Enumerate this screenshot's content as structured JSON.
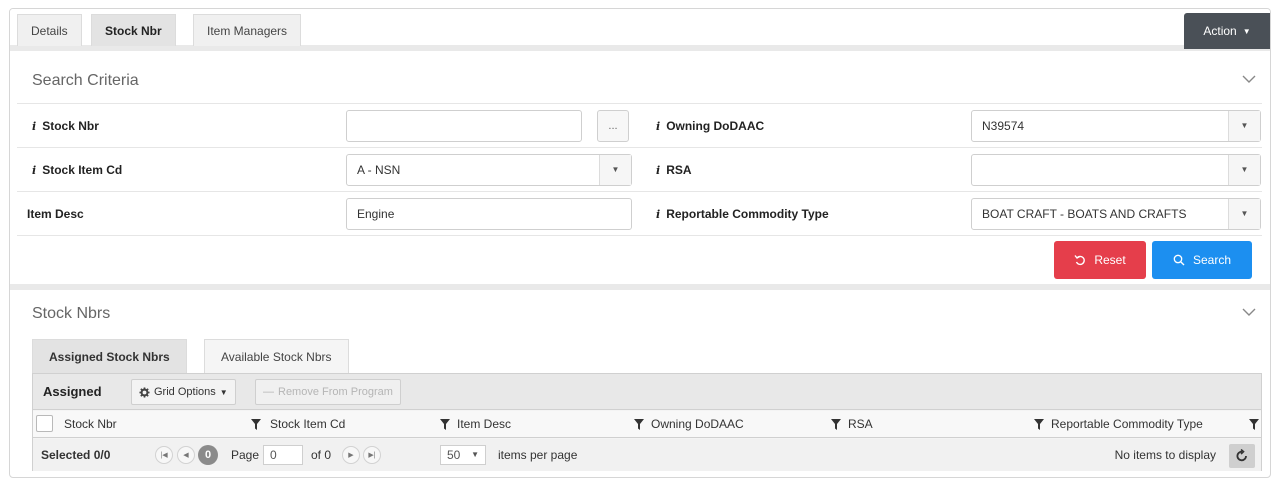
{
  "tabs": [
    {
      "label": "Details"
    },
    {
      "label": "Stock Nbr"
    },
    {
      "label": "Item Managers"
    }
  ],
  "action": {
    "label": "Action"
  },
  "search_criteria": {
    "title": "Search Criteria",
    "left": [
      {
        "label": "Stock Nbr",
        "value": ""
      },
      {
        "label": "Stock Item Cd",
        "value": "A - NSN"
      },
      {
        "label": "Item Desc",
        "value": "Engine"
      }
    ],
    "right": [
      {
        "label": "Owning DoDAAC",
        "value": "N39574"
      },
      {
        "label": "RSA",
        "value": ""
      },
      {
        "label": "Reportable Commodity Type",
        "value": "BOAT CRAFT - BOATS AND CRAFTS"
      }
    ],
    "lookup_label": "...",
    "reset_label": "Reset",
    "search_label": "Search"
  },
  "stock_nbrs": {
    "title": "Stock Nbrs",
    "tabs": [
      {
        "label": "Assigned Stock Nbrs"
      },
      {
        "label": "Available Stock Nbrs"
      }
    ],
    "grid": {
      "title": "Assigned",
      "grid_options_label": "Grid Options",
      "remove_label": "Remove From Program",
      "columns": [
        {
          "label": "Stock Nbr"
        },
        {
          "label": "Stock Item Cd"
        },
        {
          "label": "Item Desc"
        },
        {
          "label": "Owning DoDAAC"
        },
        {
          "label": "RSA"
        },
        {
          "label": "Reportable Commodity Type"
        }
      ],
      "selected_text": "Selected 0/0",
      "current_page": "0",
      "page_label": "Page",
      "page_value": "0",
      "of_text": "of 0",
      "items_per_page_value": "50",
      "items_per_page_label": "items per page",
      "no_items_text": "No items to display"
    }
  }
}
